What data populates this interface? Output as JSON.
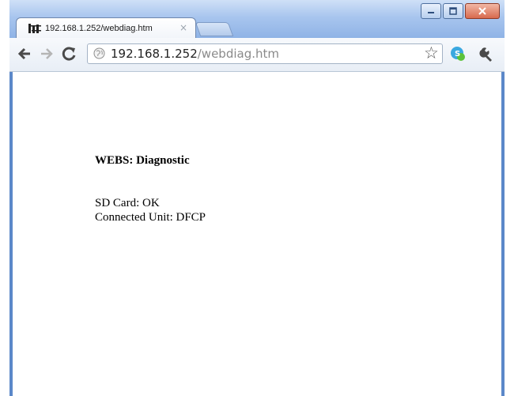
{
  "browser": {
    "tab": {
      "title": "192.168.1.252/webdiag.htm",
      "close_label": "×"
    },
    "address": {
      "host": "192.168.1.252",
      "path": "/webdiag.htm"
    }
  },
  "page": {
    "title": "WEBS: Diagnostic",
    "status_lines": [
      "SD Card: OK",
      "Connected Unit: DFCP"
    ]
  },
  "icons": {
    "back": "back-arrow-icon",
    "forward": "forward-arrow-icon",
    "reload": "reload-icon",
    "star": "bookmark-star-icon",
    "extension": "extension-icon",
    "wrench": "wrench-menu-icon"
  },
  "colors": {
    "frame": "#5b88c9",
    "titlebar": "#a8c5ee",
    "close_button": "#d86a4e"
  }
}
